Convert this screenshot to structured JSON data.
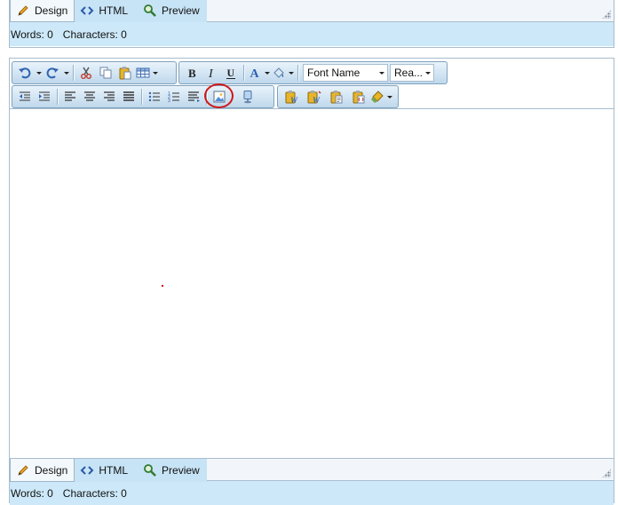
{
  "top_editor": {
    "modes": [
      {
        "label": "Design",
        "icon": "pencil-icon",
        "active": true
      },
      {
        "label": "HTML",
        "icon": "code-brackets-icon",
        "active": false
      },
      {
        "label": "Preview",
        "icon": "magnifier-icon",
        "active": false
      }
    ],
    "status": {
      "words": "Words: 0",
      "characters": "Characters: 0"
    }
  },
  "main_editor": {
    "toolbar": {
      "font_name": "Font Name",
      "font_size": "Rea...",
      "row1_groups": [
        [
          "undo-icon",
          "redo-icon",
          "cut-icon",
          "copy-icon",
          "paste-icon",
          "table-icon"
        ],
        [
          "bold-icon",
          "italic-icon",
          "underline-icon",
          "font-color-icon",
          "highlight-color-icon"
        ]
      ],
      "row2_groups": [
        [
          "outdent-icon",
          "indent-icon",
          "align-left-icon",
          "align-center-icon",
          "align-right-icon",
          "justify-icon",
          "bulleted-list-icon",
          "numbered-list-icon",
          "paragraph-icon",
          "insert-image-icon",
          "insert-media-icon"
        ],
        [
          "paste-from-word-icon",
          "paste-from-word-clean-icon",
          "paste-plain-text-icon",
          "paste-as-html-icon",
          "format-stripper-icon"
        ]
      ],
      "icon_colors": {
        "blue": "#2f62b2",
        "yellow": "#e8b526",
        "gray": "#5a5a5a"
      },
      "highlight_color": "#d01818"
    },
    "modes": [
      {
        "label": "Design",
        "icon": "pencil-icon",
        "active": true
      },
      {
        "label": "HTML",
        "icon": "code-brackets-icon",
        "active": false
      },
      {
        "label": "Preview",
        "icon": "magnifier-icon",
        "active": false
      }
    ],
    "status": {
      "words": "Words: 0",
      "characters": "Characters: 0"
    }
  }
}
